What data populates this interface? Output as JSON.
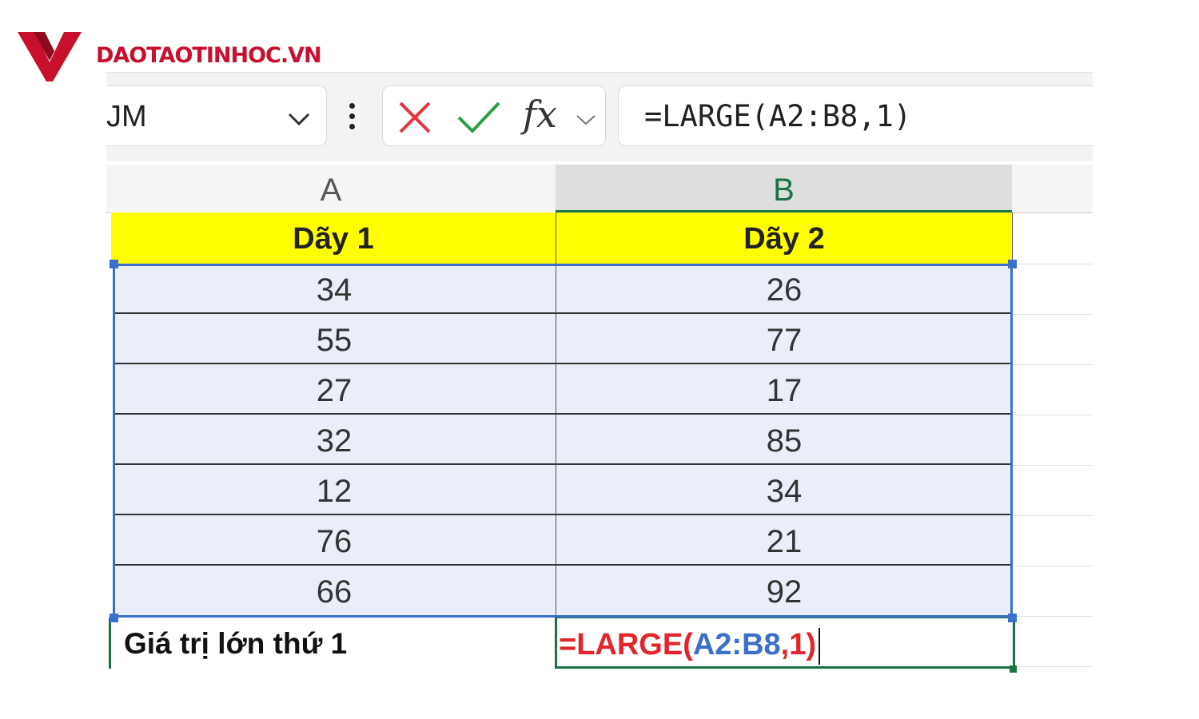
{
  "logo": {
    "text": "DAOTAOTINHOC.VN",
    "color": "#c8102e"
  },
  "name_box": {
    "value": "JM"
  },
  "formula_bar": {
    "fx_label": "fx",
    "formula": "=LARGE(A2:B8,1)"
  },
  "columns": [
    {
      "letter": "A"
    },
    {
      "letter": "B"
    }
  ],
  "table": {
    "headers": [
      "Dãy 1",
      "Dãy 2"
    ],
    "rows": [
      [
        "34",
        "26"
      ],
      [
        "55",
        "77"
      ],
      [
        "27",
        "17"
      ],
      [
        "32",
        "85"
      ],
      [
        "12",
        "34"
      ],
      [
        "76",
        "21"
      ],
      [
        "66",
        "92"
      ]
    ],
    "result_label": "Giá trị lớn thứ 1",
    "result_formula": {
      "prefix": "=LARGE(",
      "range": "A2:B8",
      "suffix": ",1)"
    }
  },
  "colors": {
    "header_fill": "#ffff00",
    "selection_fill": "#e9eef8",
    "selection_border": "#3b6fcb",
    "active_border": "#1a7343",
    "formula_red": "#e4242b",
    "formula_blue": "#3d6ec9"
  }
}
